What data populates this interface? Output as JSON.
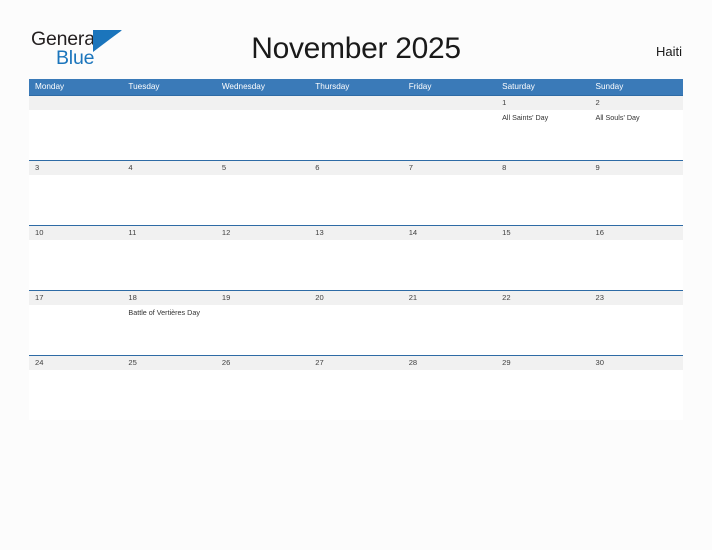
{
  "brand": {
    "name_part1": "General",
    "name_part2": "Blue",
    "flag_icon": "flag-triangle-icon",
    "blue": "#1b75bc"
  },
  "header": {
    "title": "November 2025",
    "country": "Haiti"
  },
  "theme": {
    "header_blue": "#3a7ab8",
    "rule_blue": "#2e6ba5",
    "date_strip_gray": "#f1f1f1",
    "page_background": "#fcfcfc"
  },
  "calendar": {
    "month": "November",
    "year": "2025",
    "weekday_headers": [
      "Monday",
      "Tuesday",
      "Wednesday",
      "Thursday",
      "Friday",
      "Saturday",
      "Sunday"
    ],
    "weeks": [
      {
        "days": [
          {
            "date": "",
            "event": ""
          },
          {
            "date": "",
            "event": ""
          },
          {
            "date": "",
            "event": ""
          },
          {
            "date": "",
            "event": ""
          },
          {
            "date": "",
            "event": ""
          },
          {
            "date": "1",
            "event": "All Saints' Day"
          },
          {
            "date": "2",
            "event": "All Souls' Day"
          }
        ]
      },
      {
        "days": [
          {
            "date": "3",
            "event": ""
          },
          {
            "date": "4",
            "event": ""
          },
          {
            "date": "5",
            "event": ""
          },
          {
            "date": "6",
            "event": ""
          },
          {
            "date": "7",
            "event": ""
          },
          {
            "date": "8",
            "event": ""
          },
          {
            "date": "9",
            "event": ""
          }
        ]
      },
      {
        "days": [
          {
            "date": "10",
            "event": ""
          },
          {
            "date": "11",
            "event": ""
          },
          {
            "date": "12",
            "event": ""
          },
          {
            "date": "13",
            "event": ""
          },
          {
            "date": "14",
            "event": ""
          },
          {
            "date": "15",
            "event": ""
          },
          {
            "date": "16",
            "event": ""
          }
        ]
      },
      {
        "days": [
          {
            "date": "17",
            "event": ""
          },
          {
            "date": "18",
            "event": "Battle of Vertières Day"
          },
          {
            "date": "19",
            "event": ""
          },
          {
            "date": "20",
            "event": ""
          },
          {
            "date": "21",
            "event": ""
          },
          {
            "date": "22",
            "event": ""
          },
          {
            "date": "23",
            "event": ""
          }
        ]
      },
      {
        "days": [
          {
            "date": "24",
            "event": ""
          },
          {
            "date": "25",
            "event": ""
          },
          {
            "date": "26",
            "event": ""
          },
          {
            "date": "27",
            "event": ""
          },
          {
            "date": "28",
            "event": ""
          },
          {
            "date": "29",
            "event": ""
          },
          {
            "date": "30",
            "event": ""
          }
        ]
      }
    ]
  }
}
